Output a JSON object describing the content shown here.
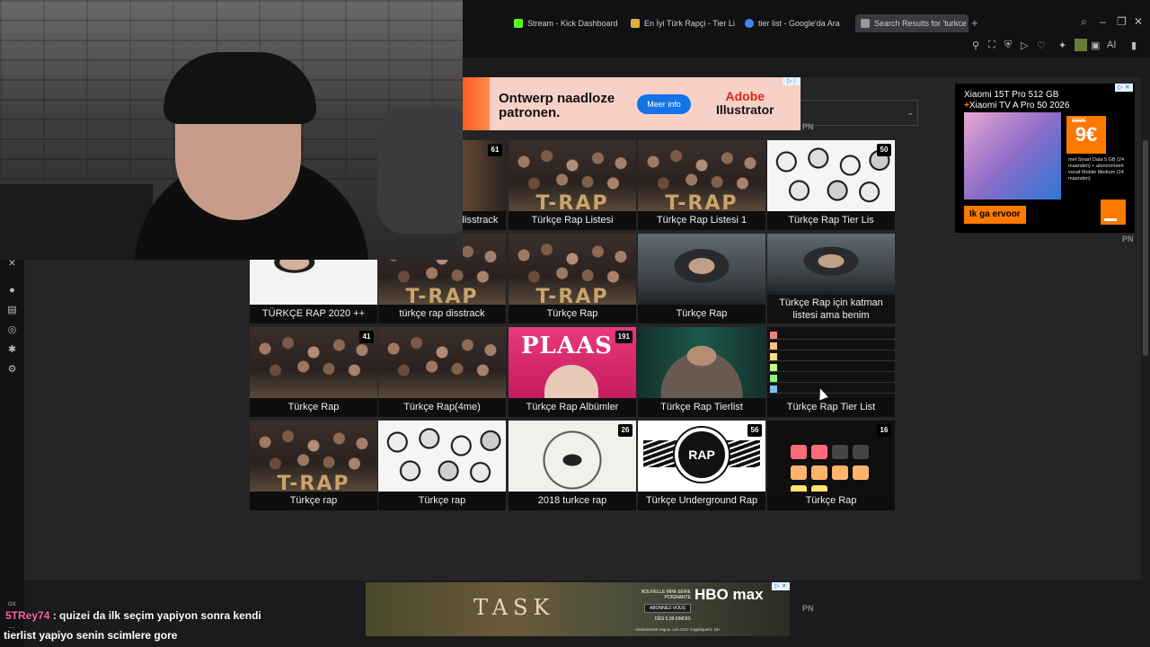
{
  "browser": {
    "tabs": [
      {
        "label": "Stream - Kick Dashboard",
        "color": "#53fc18"
      },
      {
        "label": "En İyi Türk Rapçi - Tier Lis",
        "color": "#e0b040"
      },
      {
        "label": "tier list - Google'da Ara",
        "color": "#4285f4"
      },
      {
        "label": "Search Results for 'turkce",
        "color": "#999999"
      }
    ],
    "new_tab": "+",
    "toolbar_ai": "AI"
  },
  "ads": {
    "top": {
      "headline": "Ontwerp naadloze patronen.",
      "button": "Meer info",
      "brand_line1": "Adobe",
      "brand_line2": "Illustrator",
      "adchoices": "▷ ⁝"
    },
    "right": {
      "title1": "Xiaomi 15T Pro 512 GB",
      "title2_plus": "+",
      "title2": "Xiaomi TV A Pro 50 2026",
      "old_price": "899€",
      "price": "9€",
      "small": "met Smart Data 5 GB (24 maanden) + abonnement vanaf Mobile Medium (24 maanden)",
      "cta": "Ik ga ervoor",
      "adchoices": "▷ ✕"
    },
    "bottom": {
      "title": "TASK",
      "tagline": "NOUVELLE MINI-SÉRIE POIGNANTE",
      "brand": "HBO max",
      "watch": "ABONNEZ-VOUS",
      "price": "DÈS 5,99 €/MOIS",
      "legal": "Abonnement requis. Les CGV s'appliquent. 18+",
      "adchoices": "▷ ✕"
    }
  },
  "pn_marks": [
    "PN",
    "PN",
    "PN"
  ],
  "grid": [
    {
      "label": "disstrack",
      "count": "61"
    },
    {
      "label": "Türkçe Rap Listesi",
      "count": ""
    },
    {
      "label": "Türkçe Rap Listesi 1",
      "count": ""
    },
    {
      "label": "Türkçe Rap Tier Lis",
      "count": "50"
    },
    {
      "label": "TÜRKÇE RAP 2020 ++",
      "count": ""
    },
    {
      "label": "türkçe rap disstrack",
      "count": ""
    },
    {
      "label": "Türkçe Rap",
      "count": ""
    },
    {
      "label": "Türkçe Rap",
      "count": ""
    },
    {
      "label": "Türkçe Rap için katman listesi ama benim",
      "count": ""
    },
    {
      "label": "Türkçe Rap",
      "count": "41"
    },
    {
      "label": "Türkçe Rap(4me)",
      "count": ""
    },
    {
      "label": "Türkçe Rap Albümler",
      "count": "191"
    },
    {
      "label": "Türkçe Rap Tierlist",
      "count": ""
    },
    {
      "label": "Türkçe Rap Tier List",
      "count": ""
    },
    {
      "label": "Türkçe rap",
      "count": ""
    },
    {
      "label": "Türkçe rap",
      "count": ""
    },
    {
      "label": "2018 turkce rap",
      "count": "26"
    },
    {
      "label": "Türkçe Underground Rap",
      "count": "56"
    },
    {
      "label": "Türkçe Rap",
      "count": "16"
    }
  ],
  "thumb_text": {
    "trap": "T-RAP",
    "plaas": "PLAAS",
    "rap_logo": "RAP"
  },
  "chat": {
    "badge": "GX",
    "user": "5TRey74",
    "separator": " : ",
    "message_line1": "quizei da ilk seçim yapiyon sonra kendi",
    "dots": "…",
    "message_line2": "tierlist yapiyo senin scimlere gore"
  },
  "colors": {
    "accent_kick": "#53fc18",
    "orange": "#ff7900",
    "plaas_pink": "#e8397b"
  }
}
